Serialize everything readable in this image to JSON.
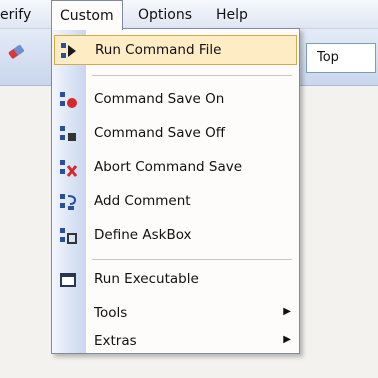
{
  "menubar": {
    "items": [
      {
        "label": "erify",
        "active": false
      },
      {
        "label": "Custom",
        "active": true
      },
      {
        "label": "Options",
        "active": false
      },
      {
        "label": "Help",
        "active": false
      }
    ]
  },
  "toolbar": {
    "combo_value": "Top"
  },
  "custom_menu": {
    "items": [
      {
        "label": "Run Command File",
        "icon": "run-command-file-icon",
        "highlighted": true
      },
      {
        "label": "Command Save On",
        "icon": "command-save-on-icon"
      },
      {
        "label": "Command Save Off",
        "icon": "command-save-off-icon"
      },
      {
        "label": "Abort Command Save",
        "icon": "abort-command-save-icon"
      },
      {
        "label": "Add Comment",
        "icon": "add-comment-icon"
      },
      {
        "label": "Define AskBox",
        "icon": "define-askbox-icon"
      },
      {
        "label": "Run Executable",
        "icon": "run-executable-icon"
      },
      {
        "label": "Tools",
        "submenu": true
      },
      {
        "label": "Extras",
        "submenu": true
      }
    ],
    "submenu_arrow": "▶"
  },
  "colors": {
    "highlight_bg": "#fdecc4",
    "highlight_border": "#d8a94a",
    "icon_blue": "#2a4f9b",
    "icon_red": "#d42a2a"
  }
}
